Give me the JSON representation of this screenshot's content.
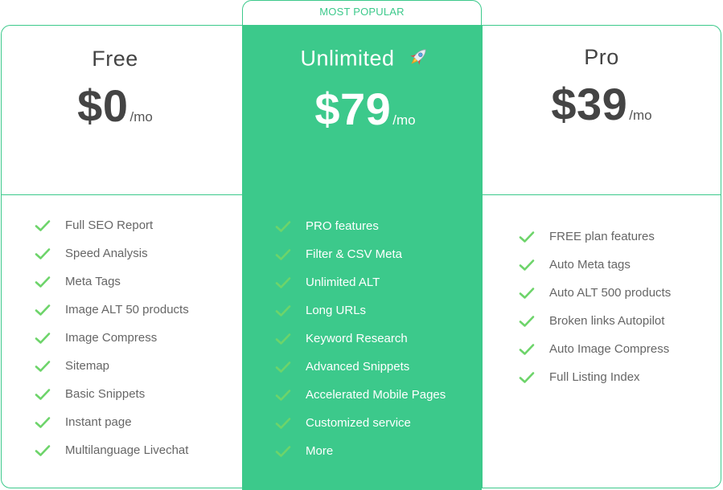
{
  "badge": "MOST POPULAR",
  "colors": {
    "accent": "#3cc98b",
    "check": "#6dd46a",
    "text": "#444444"
  },
  "plans": [
    {
      "name": "Free",
      "price": "$0",
      "period": "/mo",
      "features": [
        "Full SEO Report",
        "Speed Analysis",
        "Meta Tags",
        "Image ALT 50 products",
        "Image Compress",
        "Sitemap",
        "Basic Snippets",
        "Instant page",
        "Multilanguage Livechat"
      ]
    },
    {
      "name": "Unlimited",
      "icon": "rocket-icon",
      "price": "$79",
      "period": "/mo",
      "features": [
        "PRO features",
        "Filter & CSV Meta",
        "Unlimited ALT",
        "Long URLs",
        "Keyword Research",
        "Advanced Snippets",
        "Accelerated Mobile Pages",
        "Customized service",
        "More"
      ]
    },
    {
      "name": "Pro",
      "price": "$39",
      "period": "/mo",
      "features": [
        "FREE plan features",
        "Auto Meta tags",
        "Auto ALT 500 products",
        "Broken links Autopilot",
        "Auto Image Compress",
        "Full Listing Index"
      ]
    }
  ]
}
